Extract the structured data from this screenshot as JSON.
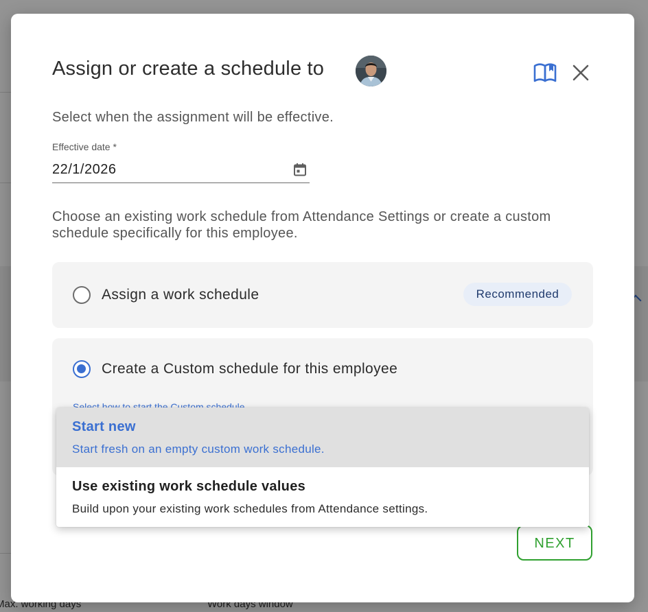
{
  "modal": {
    "title": "Assign or create a schedule to",
    "intro": "Select when the assignment will be effective.",
    "effective_date": {
      "label": "Effective date *",
      "value": "22/1/2026"
    },
    "choose_text": "Choose an existing work schedule from Attendance Settings or create a custom schedule specifically for this employee.",
    "options": [
      {
        "label": "Assign a work schedule",
        "selected": false,
        "badge": "Recommended"
      },
      {
        "label": "Create a Custom schedule for this employee",
        "selected": true,
        "hint": "Select how to start the Custom schedule"
      }
    ],
    "dropdown": [
      {
        "title": "Start new",
        "description": "Start fresh on an empty custom work schedule.",
        "highlighted": true
      },
      {
        "title": "Use existing work schedule values",
        "description": "Build upon your existing work schedules from Attendance settings.",
        "highlighted": false
      }
    ],
    "next_label": "NEXT"
  },
  "background": {
    "col1_label": "Max. working days",
    "col2_label": "Work days window"
  },
  "icons": {
    "help": "book-open-icon",
    "close": "close-icon",
    "calendar": "calendar-icon",
    "avatar": "avatar"
  },
  "colors": {
    "accent": "#3a6fd1",
    "next": "#2fa02f",
    "badge_bg": "#e8eef8"
  }
}
